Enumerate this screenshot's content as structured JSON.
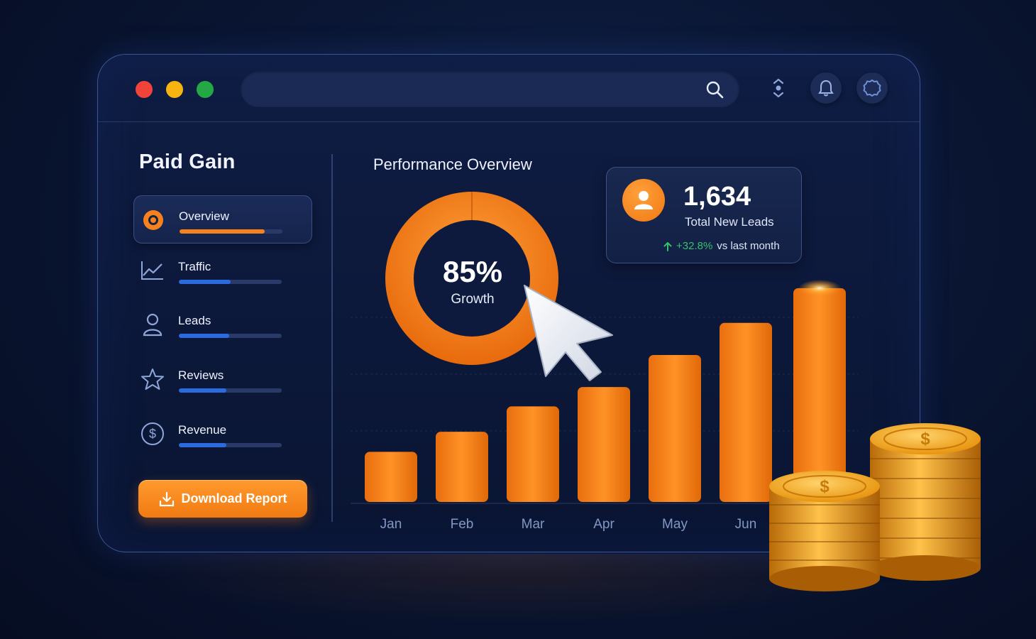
{
  "window": {
    "traffic_lights": [
      "close",
      "minimize",
      "maximize"
    ],
    "search": {
      "placeholder": "",
      "icon": "search-icon"
    },
    "header_icons": [
      "user-switch-icon",
      "bell-icon",
      "gear-icon"
    ]
  },
  "sidebar": {
    "brand": "Paid Gain",
    "items": [
      {
        "label": "Overview",
        "icon": "target-icon",
        "progress": 0.83,
        "active": true
      },
      {
        "label": "Traffic",
        "icon": "line-chart-icon",
        "progress": 0.5,
        "active": false
      },
      {
        "label": "Leads",
        "icon": "user-icon",
        "progress": 0.49,
        "active": false
      },
      {
        "label": "Reviews",
        "icon": "star-icon",
        "progress": 0.46,
        "active": false
      },
      {
        "label": "Revenue",
        "icon": "dollar-icon",
        "progress": 0.46,
        "active": false
      }
    ],
    "download_label": "Download Report"
  },
  "main": {
    "title": "Performance Overview",
    "donut": {
      "value": "85%",
      "label": "Growth",
      "fraction": 0.85
    },
    "leads_card": {
      "value": "1,634",
      "label": "Total New Leads",
      "delta": "+32.8%",
      "delta_suffix": "vs last month"
    }
  },
  "colors": {
    "accent": "#f7821d",
    "blue": "#2c6ae0",
    "positive": "#35c16a",
    "background": "#0a1634"
  },
  "chart_data": {
    "type": "bar",
    "categories": [
      "Jan",
      "Feb",
      "Mar",
      "Apr",
      "May",
      "Jun",
      ""
    ],
    "values": [
      75,
      105,
      143,
      172,
      220,
      268,
      320
    ],
    "title": "",
    "xlabel": "",
    "ylabel": "",
    "ylim": [
      0,
      340
    ],
    "grid": true
  }
}
